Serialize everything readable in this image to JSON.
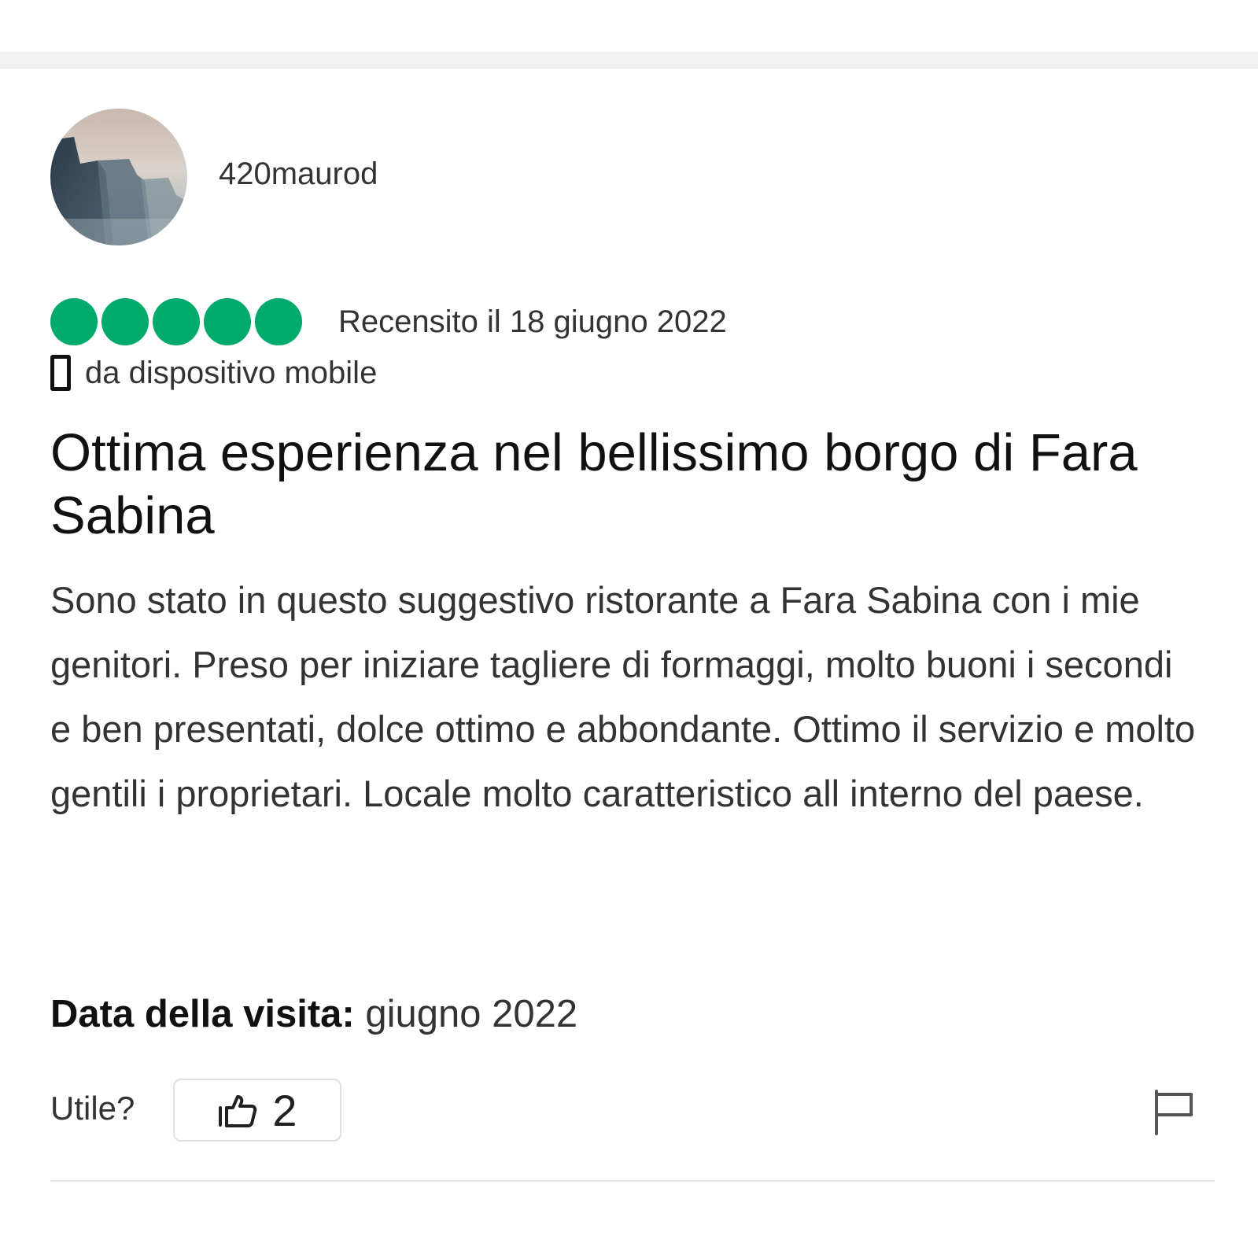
{
  "reviewer": {
    "username": "420maurod",
    "avatar_icon": "avatar-photo"
  },
  "rating": {
    "bubbles_filled": 5,
    "bubbles_total": 5,
    "color": "#00aa6c",
    "review_date": "Recensito il 18 giugno 2022"
  },
  "device": {
    "icon": "mobile-icon",
    "label": "da dispositivo mobile"
  },
  "review": {
    "title": "Ottima esperienza nel bellissimo borgo di Fara Sabina",
    "body": "Sono stato in questo suggestivo ristorante a Fara Sabina con i mie genitori. Preso per iniziare tagliere di formaggi, molto buoni i secondi e ben presentati, dolce ottimo e abbondante. Ottimo il servizio e molto gentili i proprietari. Locale molto caratteristico all interno del paese."
  },
  "visit": {
    "label": "Data della visita:",
    "value": "giugno 2022"
  },
  "helpful": {
    "label": "Utile?",
    "vote_icon": "thumbs-up-icon",
    "vote_count": "2",
    "report_icon": "flag-icon"
  }
}
